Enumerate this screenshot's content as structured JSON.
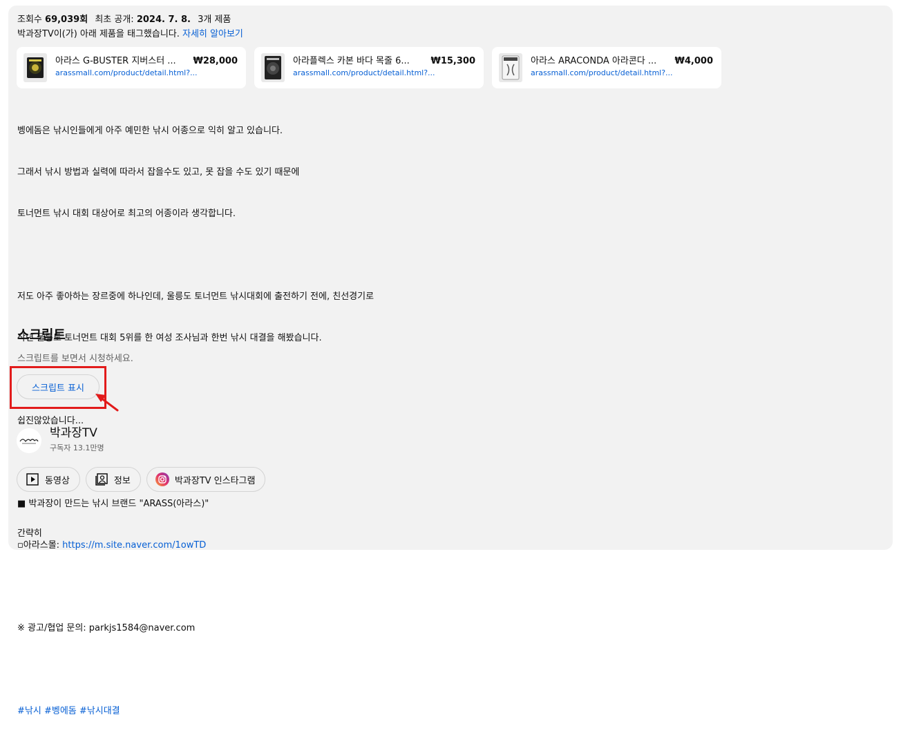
{
  "meta": {
    "views_prefix": "조회수",
    "views_value": "69,039회",
    "first_public_prefix": "최초 공개:",
    "first_public_date": "2024. 7. 8.",
    "products_count": "3개 제품"
  },
  "tagline": {
    "text": "박과장TV이(가) 아래 제품을 태그했습니다.",
    "learn_more": "자세히 알아보기"
  },
  "products": [
    {
      "name": "아라스 G-BUSTER 지버스터 ...",
      "price": "₩28,000",
      "url": "arassmall.com/product/detail.html?..."
    },
    {
      "name": "아라플렉스 카본 바다 목줄 6...",
      "price": "₩15,300",
      "url": "arassmall.com/product/detail.html?..."
    },
    {
      "name": "아라스 ARACONDA 아라콘다 ...",
      "price": "₩4,000",
      "url": "arassmall.com/product/detail.html?..."
    }
  ],
  "description": {
    "p1": [
      "벵에돔은 낚시인들에게 아주 예민한 낚시 어종으로 익히 알고 있습니다.",
      "그래서 낚시 방법과 실력에 따라서 잡을수도 있고, 못 잡을 수도 있기 때문에",
      "토너먼트 낚시 대회 대상어로 최고의 어종이라 생각합니다."
    ],
    "p2": [
      "저도 아주 좋아하는 장르중에 하나인데, 울릉도 토너먼트 낚시대회에 출전하기 전에, 친선경기로",
      "작년 울릉도 토너먼트 대회 5위를 한 여성 조사님과 한번 낚시 대결을 해봤습니다."
    ],
    "p3": "쉽진않았습니다...",
    "brand_line": "■ 박과장이 만드는 낚시 브랜드 \"ARASS(아라스)\"",
    "mall_prefix": "▫아라스몰: ",
    "mall_link": "https://m.site.naver.com/1owTD",
    "contact": "※ 광고/협업 문의: parkjs1584@naver.com",
    "hashtags": [
      "#낚시",
      "#벵에돔",
      "#낚시대결"
    ]
  },
  "transcript": {
    "title": "스크립트",
    "subtitle": "스크립트를 보면서 시청하세요.",
    "button": "스크립트 표시"
  },
  "channel": {
    "name": "박과장TV",
    "subscribers": "구독자 13.1만명",
    "chips": [
      {
        "label": "동영상",
        "icon": "video-play-icon"
      },
      {
        "label": "정보",
        "icon": "profile-info-icon"
      },
      {
        "label": "박과장TV 인스타그램",
        "icon": "instagram-icon"
      }
    ]
  },
  "collapse_label": "간략히",
  "colors": {
    "link": "#065fd4",
    "panel_bg": "#f2f2f2",
    "highlight": "#e21b1b"
  }
}
